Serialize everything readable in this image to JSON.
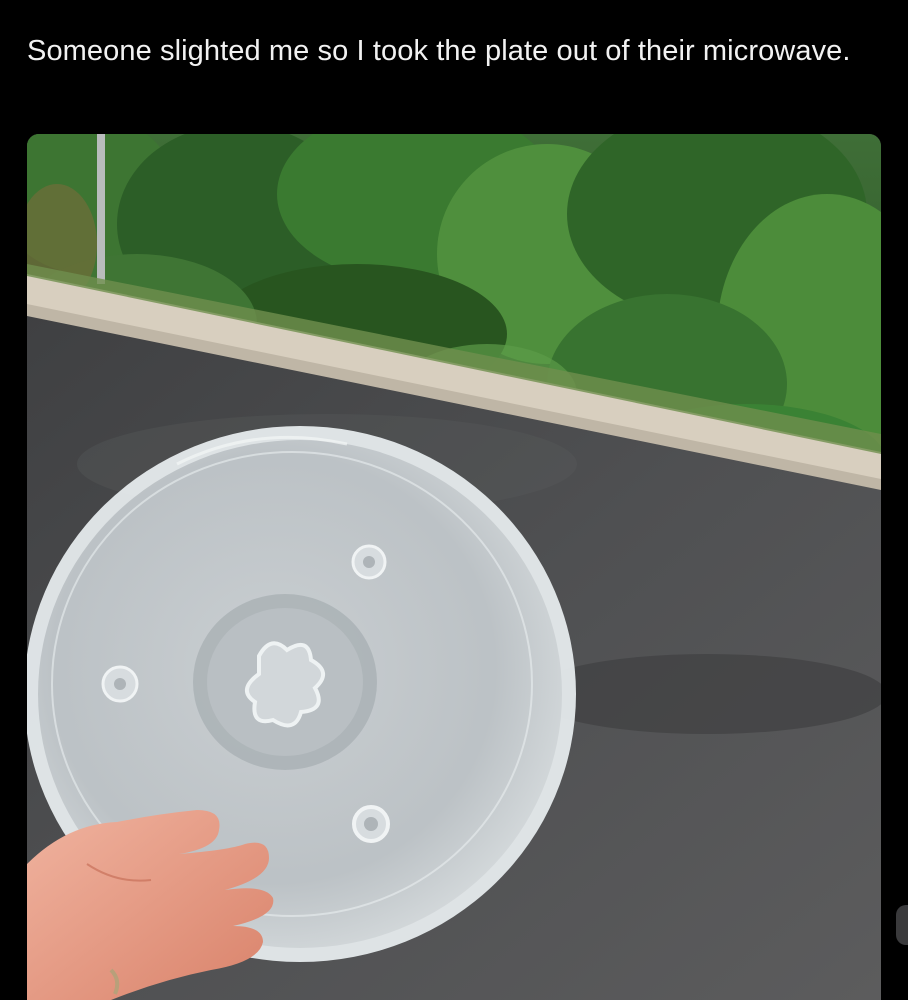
{
  "post": {
    "text": "Someone slighted me so I took the plate out of their microwave."
  },
  "photo": {
    "icon": "photo-microwave-plate",
    "subjects": [
      "bushes-icon",
      "curb-icon",
      "road-icon",
      "glass-turntable-plate-icon",
      "hand-icon"
    ]
  },
  "colors": {
    "background": "#000000",
    "text": "#f2f2f2",
    "asphalt": "#4a4b4d",
    "foliage": "#2f6b2a",
    "curb": "#d9d0c0",
    "plate": "#d8dde0",
    "hand": "#e59a83"
  }
}
